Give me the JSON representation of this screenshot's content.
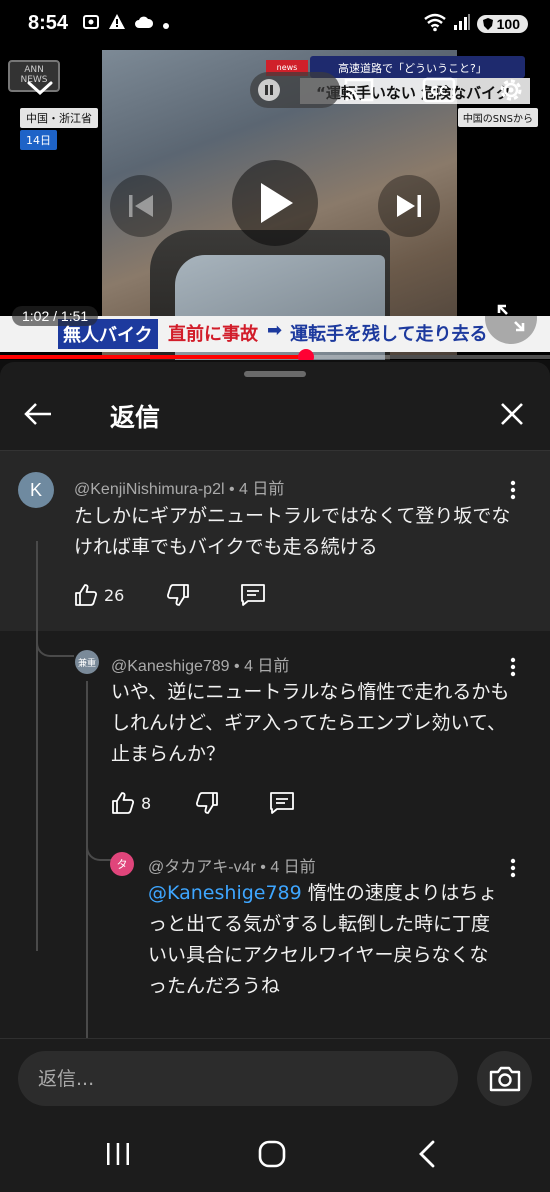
{
  "status_bar": {
    "time": "8:54",
    "battery": "100",
    "icons": [
      "screenshot-icon",
      "alert-icon",
      "cloud-icon",
      "dot-icon",
      "wifi-icon",
      "signal-icon"
    ]
  },
  "video": {
    "news_logo": "ANN NEWS",
    "news_badge": "news",
    "news_top_text": "高速道路で「どういうこと?」",
    "news_sub_text": "“運転手いない 危険なバイク",
    "location_tag": "中国・浙江省",
    "date_tag": "14日",
    "source_tag": "中国のSNSから",
    "current_time": "1:02",
    "duration": "1:51",
    "time_separator": " / ",
    "progress_fraction": 0.557,
    "caption": {
      "part1": "無人バイク",
      "part2": "直前に事故",
      "arrow": "➡",
      "part3": "運転手を残して走り去る"
    },
    "accent_color": "#ff0000"
  },
  "panel": {
    "title": "返信",
    "comments": [
      {
        "author": "@KenjiNishimura-p2l",
        "age": "4 日前",
        "meta_separator": " • ",
        "avatar_letter": "K",
        "avatar_color": "#6f8aa0",
        "text": "たしかにギアがニュートラルではなくて登り坂でなければ車でもバイクでも走る続ける",
        "likes": "26"
      },
      {
        "author": "@Kaneshige789",
        "age": "4 日前",
        "meta_separator": " • ",
        "avatar_letter": "兼重",
        "avatar_color": "#7a8a99",
        "text": "いや、逆にニュートラルなら惰性で走れるかもしれんけど、ギア入ってたらエンブレ効いて、止まらんか？",
        "likes": "8"
      },
      {
        "author": "@タカアキ-v4r",
        "age": "4 日前",
        "meta_separator": " • ",
        "avatar_letter": "タ",
        "avatar_color": "#e0457b",
        "mention": "@Kaneshige789",
        "text": " 惰性の速度よりはちょっと出てる気がするし転倒した時に丁度いい具合にアクセルワイヤー戻らなくなったんだろうね"
      }
    ],
    "reply_placeholder": "返信..."
  }
}
